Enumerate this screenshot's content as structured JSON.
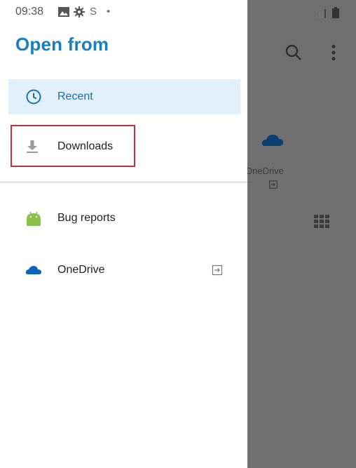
{
  "status_bar": {
    "time": "09:38",
    "icons": [
      "gallery-icon",
      "settings-icon",
      "s-icon",
      "dot-icon",
      "signal-icon",
      "battery-icon"
    ]
  },
  "drawer": {
    "title": "Open from",
    "items": [
      {
        "label": "Recent",
        "icon": "clock-icon",
        "selected": true
      },
      {
        "label": "Downloads",
        "icon": "download-icon",
        "highlighted": true
      },
      {
        "label": "Bug reports",
        "icon": "android-icon"
      },
      {
        "label": "OneDrive",
        "icon": "onedrive-cloud-icon",
        "action_icon": "sign-in-icon"
      }
    ]
  },
  "background": {
    "onedrive_label": "OneDrive",
    "icons": [
      "search-icon",
      "more-vert-icon",
      "onedrive-cloud-icon",
      "sign-in-icon",
      "grid-view-icon"
    ]
  },
  "colors": {
    "accent": "#1a7fc1",
    "selected_bg": "#e2f0fb",
    "highlight_border": "#c0303a",
    "scrim": "#6f6f6f",
    "onedrive_blue": "#0a64b8",
    "android_green": "#8bc34a"
  }
}
